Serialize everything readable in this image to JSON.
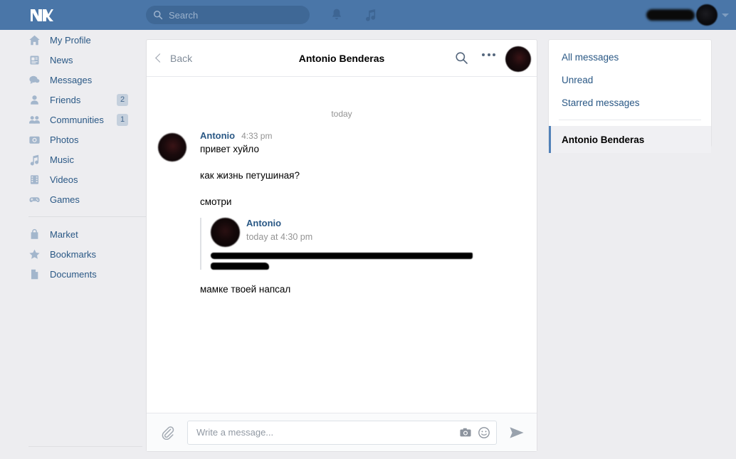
{
  "topbar": {
    "logo": "vk-logo",
    "search": {
      "placeholder": "Search",
      "value": "",
      "icon": "search-icon"
    },
    "notifications_icon": "bell-icon",
    "music_icon": "music-note-icon",
    "user": {
      "name_redacted": "",
      "avatar": "user-avatar",
      "caret": "chevron-down-icon"
    },
    "accent": "#4a76a8",
    "search_bg": "#3f6896"
  },
  "sidebar": {
    "items": [
      {
        "label": "My Profile",
        "icon": "home-icon",
        "badge": ""
      },
      {
        "label": "News",
        "icon": "news-icon",
        "badge": ""
      },
      {
        "label": "Messages",
        "icon": "messages-icon",
        "badge": ""
      },
      {
        "label": "Friends",
        "icon": "friend-icon",
        "badge": "2"
      },
      {
        "label": "Communities",
        "icon": "community-icon",
        "badge": "1"
      },
      {
        "label": "Photos",
        "icon": "camera-icon",
        "badge": ""
      },
      {
        "label": "Music",
        "icon": "music-note-icon",
        "badge": ""
      },
      {
        "label": "Videos",
        "icon": "video-icon",
        "badge": ""
      },
      {
        "label": "Games",
        "icon": "gamepad-icon",
        "badge": ""
      }
    ],
    "items2": [
      {
        "label": "Market",
        "icon": "bag-icon",
        "badge": ""
      },
      {
        "label": "Bookmarks",
        "icon": "star-icon",
        "badge": ""
      },
      {
        "label": "Documents",
        "icon": "document-icon",
        "badge": ""
      }
    ],
    "link_color": "#2a5885",
    "bg": "#ededf0"
  },
  "chat": {
    "header": {
      "back_label": "Back",
      "title": "Antonio Benderas",
      "search_icon": "search-icon",
      "more_icon": "more-options-icon",
      "avatar": "contact-avatar"
    },
    "day_separator": "today",
    "message": {
      "author": "Antonio",
      "time": "4:33 pm",
      "lines": [
        "привет хуйло",
        "как жизнь петушиная?",
        "смотри"
      ],
      "forwarded": {
        "author": "Antonio",
        "time": "today at 4:30 pm",
        "redacted_lines": [
          "",
          ""
        ]
      },
      "trailing_line": "мамке твоей напсал"
    },
    "composer": {
      "attach_icon": "paperclip-icon",
      "placeholder": "Write a message...",
      "value": "",
      "camera_icon": "camera-icon",
      "emoji_icon": "smiley-icon",
      "send_icon": "send-icon"
    }
  },
  "right_panel": {
    "items": [
      {
        "label": "All messages"
      },
      {
        "label": "Unread"
      },
      {
        "label": "Starred messages"
      }
    ],
    "selected": {
      "label": "Antonio Benderas"
    },
    "accent": "#5181b8"
  }
}
